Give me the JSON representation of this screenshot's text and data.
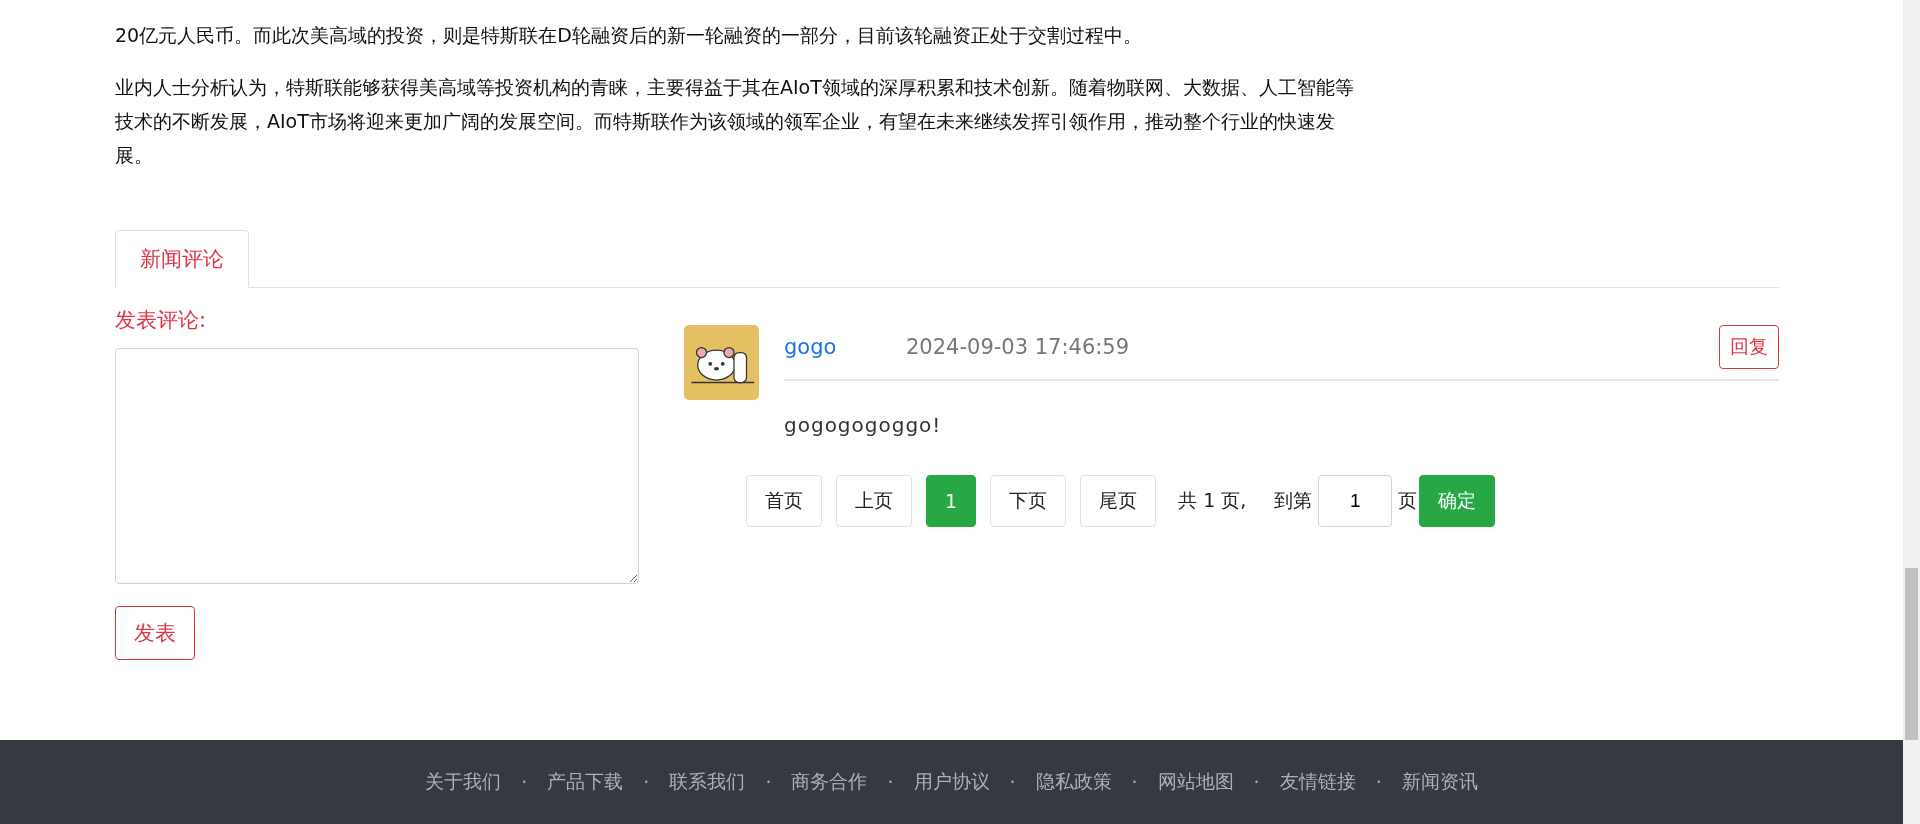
{
  "article": {
    "paragraphs": [
      "20亿元人民币。而此次美高域的投资，则是特斯联在D轮融资后的新一轮融资的一部分，目前该轮融资正处于交割过程中。",
      "业内人士分析认为，特斯联能够获得美高域等投资机构的青睐，主要得益于其在AIoT领域的深厚积累和技术创新。随着物联网、大数据、人工智能等技术的不断发展，AIoT市场将迎来更加广阔的发展空间。而特斯联作为该领域的领军企业，有望在未来继续发挥引领作用，推动整个行业的快速发展。"
    ]
  },
  "tabs": [
    {
      "label": "新闻评论",
      "selected": true
    }
  ],
  "comment_form": {
    "label": "发表评论:",
    "submit": "发表"
  },
  "comments": [
    {
      "user": "gogo",
      "time": "2024-09-03 17:46:59",
      "reply": "回复",
      "text": "gogogogoggo!"
    }
  ],
  "pagination": {
    "items": [
      {
        "label": "首页",
        "selected": false
      },
      {
        "label": "上页",
        "selected": false
      },
      {
        "label": "1",
        "selected": true
      },
      {
        "label": "下页",
        "selected": false
      },
      {
        "label": "尾页",
        "selected": false
      }
    ],
    "total": "共 1 页,",
    "goto_label": "到第",
    "goto_value": "1",
    "goto_suffix": "页",
    "confirm": "确定"
  },
  "footer": {
    "links": [
      "关于我们",
      "产品下载",
      "联系我们",
      "商务合作",
      "用户协议",
      "隐私政策",
      "网站地图",
      "友情链接",
      "新闻资讯"
    ],
    "separators": [
      "·",
      "·",
      "·",
      "·",
      "·",
      "·",
      "·",
      "·"
    ]
  }
}
